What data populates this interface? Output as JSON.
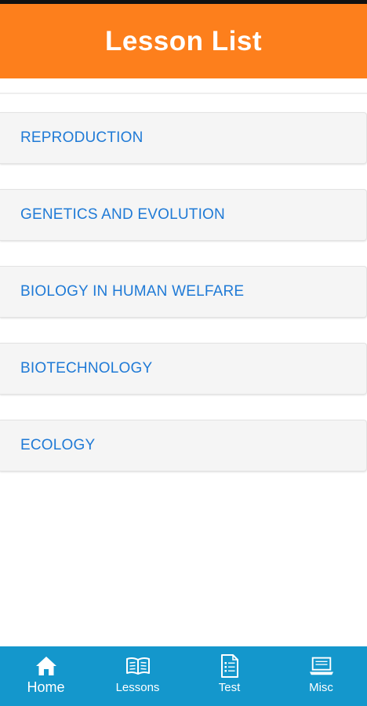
{
  "header": {
    "title": "Lesson List",
    "background_color": "#fd7f1c"
  },
  "lessons": [
    {
      "label": "REPRODUCTION"
    },
    {
      "label": "GENETICS AND EVOLUTION"
    },
    {
      "label": "BIOLOGY IN HUMAN WELFARE"
    },
    {
      "label": "BIOTECHNOLOGY"
    },
    {
      "label": "ECOLOGY"
    }
  ],
  "bottom_nav": {
    "background_color": "#1497cc",
    "items": [
      {
        "label": "Home",
        "icon": "home-icon",
        "active": true
      },
      {
        "label": "Lessons",
        "icon": "book-icon",
        "active": false
      },
      {
        "label": "Test",
        "icon": "document-list-icon",
        "active": false
      },
      {
        "label": "Misc",
        "icon": "laptop-icon",
        "active": false
      }
    ]
  },
  "colors": {
    "lesson_text": "#1f7ad6",
    "lesson_background": "#f5f5f5"
  }
}
